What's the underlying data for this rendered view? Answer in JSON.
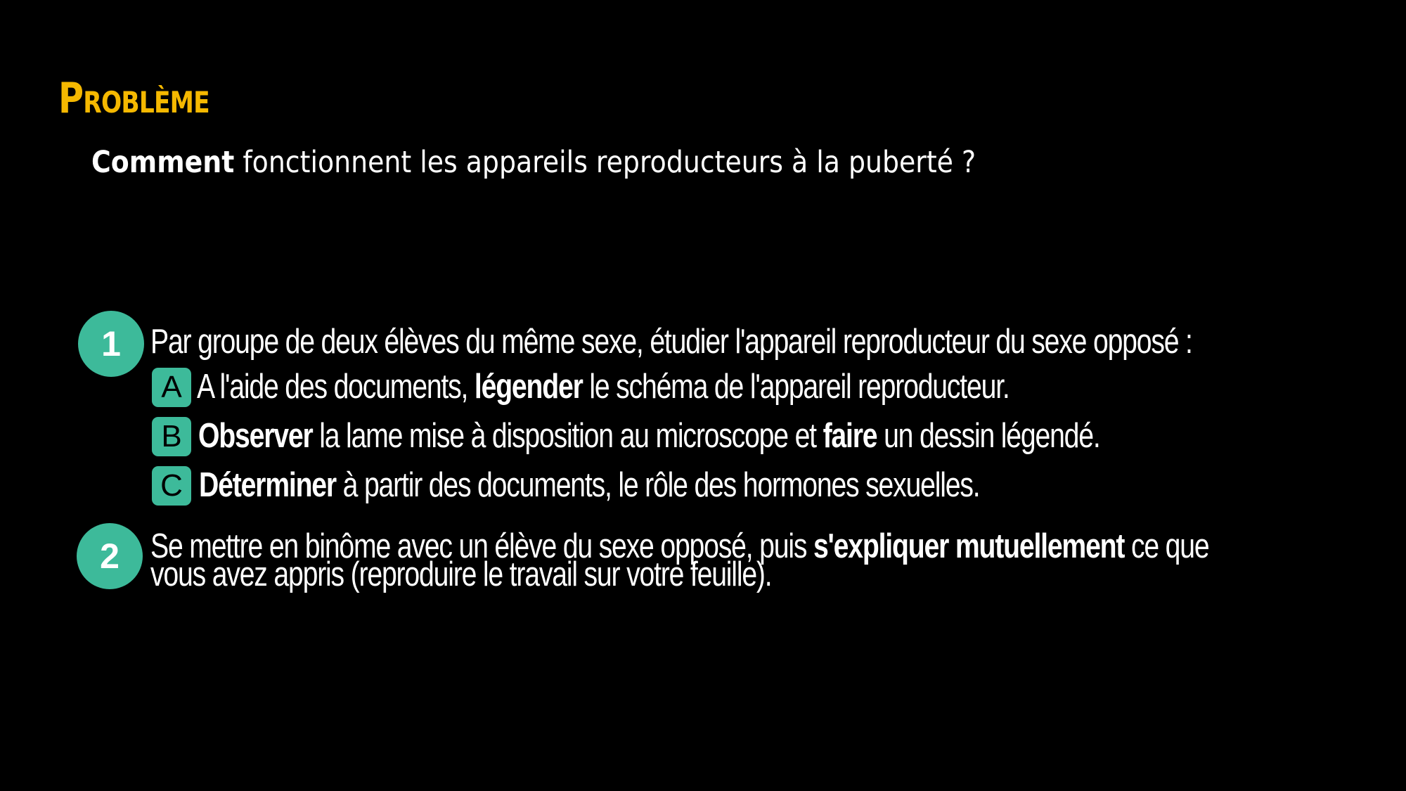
{
  "title": "Problème",
  "question": {
    "bold": "Comment",
    "rest": " fonctionnent les appareils reproducteurs à la puberté ?"
  },
  "colors": {
    "title": "#f5b800",
    "accent": "#3dba9a",
    "background": "#000000"
  },
  "steps": [
    {
      "number": "1",
      "text": "Par groupe de deux élèves du même sexe, étudier l'appareil reproducteur du sexe opposé :",
      "subitems": [
        {
          "letter": "A",
          "pre": "A l'aide des documents, ",
          "bold": "légender",
          "post": " le schéma de l'appareil reproducteur."
        },
        {
          "letter": "B",
          "bold": "Observer",
          "mid": " la lame mise à disposition au microscope et ",
          "bold2": "faire",
          "post": " un dessin légendé."
        },
        {
          "letter": "C",
          "bold": "Déterminer",
          "post": " à partir des documents, le rôle des hormones sexuelles."
        }
      ]
    },
    {
      "number": "2",
      "pre": "Se mettre en binôme avec un élève du sexe opposé, puis ",
      "bold": "s'expliquer mutuellement",
      "post": " ce que",
      "line2": "vous avez appris (reproduire le travail sur votre feuille)."
    }
  ]
}
